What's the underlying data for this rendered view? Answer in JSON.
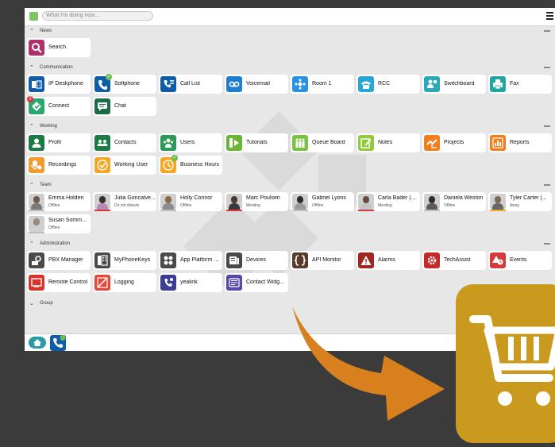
{
  "topbar": {
    "status_placeholder": "What I'm doing now..."
  },
  "sections": {
    "news": "News",
    "communication": "Communication",
    "working": "Working",
    "team": "Team",
    "administration": "Administration",
    "group": "Group"
  },
  "news": [
    {
      "label": "Search",
      "icon": "search-icon",
      "color": "#b0306a"
    }
  ],
  "communication": [
    {
      "label": "IP Deskphone",
      "icon": "deskphone-icon",
      "color": "#0f5da8"
    },
    {
      "label": "Softphone",
      "icon": "softphone-icon",
      "color": "#0f5da8",
      "badge": "✓"
    },
    {
      "label": "Call List",
      "icon": "call-list-icon",
      "color": "#0f5da8"
    },
    {
      "label": "Voicemail",
      "icon": "voicemail-icon",
      "color": "#1c7fd1"
    },
    {
      "label": "Room 1",
      "icon": "room-icon",
      "color": "#2a92e0"
    },
    {
      "label": "RCC",
      "icon": "rcc-phone-icon",
      "color": "#29a6d8"
    },
    {
      "label": "Switchboard",
      "icon": "switchboard-icon",
      "color": "#29a9b8"
    },
    {
      "label": "Fax",
      "icon": "fax-icon",
      "color": "#1fa7a0"
    },
    {
      "label": "Connect",
      "icon": "connect-icon",
      "color": "#2aa86e",
      "badge": "2"
    },
    {
      "label": "Chat",
      "icon": "chat-icon",
      "color": "#1b6b44"
    }
  ],
  "working": [
    {
      "label": "Profil",
      "icon": "profile-icon",
      "color": "#1c7a45"
    },
    {
      "label": "Contacts",
      "icon": "contacts-icon",
      "color": "#1c7a45"
    },
    {
      "label": "Users",
      "icon": "users-icon",
      "color": "#2b9a56"
    },
    {
      "label": "Tutorials",
      "icon": "tutorials-icon",
      "color": "#6ab633"
    },
    {
      "label": "Queue Board",
      "icon": "queue-board-icon",
      "color": "#7cc242"
    },
    {
      "label": "Notes",
      "icon": "notes-icon",
      "color": "#93c93e"
    },
    {
      "label": "Projects",
      "icon": "projects-icon",
      "color": "#f07f1e"
    },
    {
      "label": "Reports",
      "icon": "reports-icon",
      "color": "#f07f1e"
    },
    {
      "label": "Recordings",
      "icon": "recordings-icon",
      "color": "#f39a2a"
    },
    {
      "label": "Working User",
      "icon": "working-user-icon",
      "color": "#f5a623"
    },
    {
      "label": "Business Hours",
      "icon": "business-hours-icon",
      "color": "#f5a623",
      "badge": "✓"
    }
  ],
  "team": [
    {
      "name": "Emma Holden",
      "status": "Offline",
      "presence": "#bdbdbd",
      "hair": "#6d5a4a",
      "shirt": "#7a7a7a"
    },
    {
      "name": "Julia Goncalve...",
      "status": "Do not disturb",
      "presence": "#d9373b",
      "hair": "#3a2e28",
      "shirt": "#b58bb6"
    },
    {
      "name": "Holly Connor",
      "status": "Offline",
      "presence": "#bdbdbd",
      "hair": "#8a6b48",
      "shirt": "#8c8c8c"
    },
    {
      "name": "Marc Poulsen",
      "status": "Meeting",
      "presence": "#d9373b",
      "hair": "#4a3a30",
      "shirt": "#3a3a3a"
    },
    {
      "name": "Gabriel Lyons",
      "status": "Offline",
      "presence": "#bdbdbd",
      "hair": "#2c2c2c",
      "shirt": "#9a9a9a"
    },
    {
      "name": "Carla Bader (...",
      "status": "Meeting",
      "presence": "#d9373b",
      "hair": "#6b4a3a",
      "shirt": "#c4c4c4"
    },
    {
      "name": "Daniela Weston",
      "status": "Offline",
      "presence": "#bdbdbd",
      "hair": "#3a2a22",
      "shirt": "#5a5a5a"
    },
    {
      "name": "Tyler Carter (...",
      "status": "Away",
      "presence": "#f5a623",
      "hair": "#7a6a5a",
      "shirt": "#666666"
    },
    {
      "name": "Susan Somm...",
      "status": "Offline",
      "presence": "#bdbdbd",
      "hair": "#9a8a7a",
      "shirt": "#d0d0d0"
    }
  ],
  "administration": [
    {
      "label": "PBX Manager",
      "icon": "pbx-manager-icon",
      "color": "#4a4a4a"
    },
    {
      "label": "MyPhoneKeys",
      "icon": "phone-keys-icon",
      "color": "#4a4a4a"
    },
    {
      "label": "App Platform ...",
      "icon": "app-platform-icon",
      "color": "#4a4a4a"
    },
    {
      "label": "Devices",
      "icon": "devices-icon",
      "color": "#4a4a4a"
    },
    {
      "label": "API Monitor",
      "icon": "api-monitor-icon",
      "color": "#5a3a2a"
    },
    {
      "label": "Alarms",
      "icon": "alarm-icon",
      "color": "#a0261f"
    },
    {
      "label": "TechAssist",
      "icon": "techassist-icon",
      "color": "#c42a2a"
    },
    {
      "label": "Events",
      "icon": "events-icon",
      "color": "#d63a3a"
    },
    {
      "label": "Remote Control",
      "icon": "remote-control-icon",
      "color": "#d7342e"
    },
    {
      "label": "Logging",
      "icon": "logging-icon",
      "color": "#e14a3a"
    },
    {
      "label": "yealink",
      "icon": "yealink-icon",
      "color": "#3a3f95"
    },
    {
      "label": "Contact Widg...",
      "icon": "contact-widget-icon",
      "color": "#5a4aa8"
    }
  ],
  "colors": {
    "cart": "#c99a1e",
    "arrow": "#d9801e",
    "home": "#2b9aa3"
  }
}
